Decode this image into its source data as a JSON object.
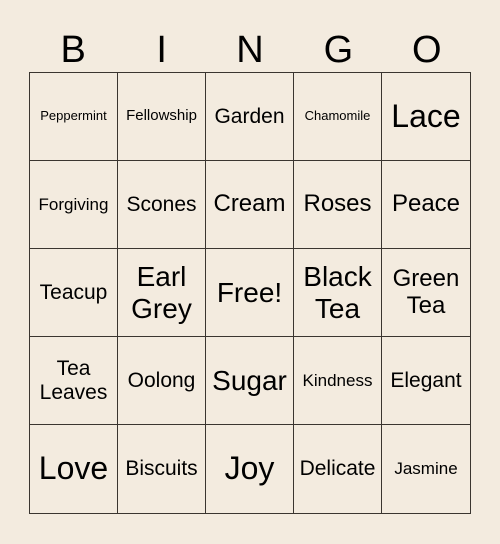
{
  "colors": {
    "background": "#F3EBDF",
    "grid_line": "#3a3530",
    "text": "#000000"
  },
  "header": {
    "letters": [
      "B",
      "I",
      "N",
      "G",
      "O"
    ]
  },
  "grid": {
    "rows": [
      [
        "Peppermint",
        "Fellowship",
        "Garden",
        "Chamomile",
        "Lace"
      ],
      [
        "Forgiving",
        "Scones",
        "Cream",
        "Roses",
        "Peace"
      ],
      [
        "Teacup",
        "Earl Grey",
        "Free!",
        "Black Tea",
        "Green Tea"
      ],
      [
        "Tea Leaves",
        "Oolong",
        "Sugar",
        "Kindness",
        "Elegant"
      ],
      [
        "Love",
        "Biscuits",
        "Joy",
        "Delicate",
        "Jasmine"
      ]
    ],
    "free_space": "Free!"
  }
}
